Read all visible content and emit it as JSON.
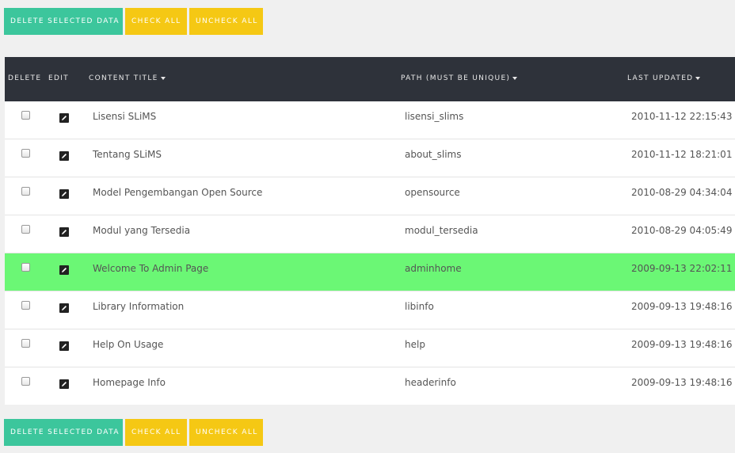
{
  "toolbar": {
    "delete_label": "DELETE SELECTED DATA",
    "check_all_label": "CHECK ALL",
    "uncheck_all_label": "UNCHECK ALL"
  },
  "table": {
    "headers": {
      "delete": "DELETE",
      "edit": "EDIT",
      "title": "CONTENT TITLE",
      "path": "PATH (MUST BE UNIQUE)",
      "updated": "LAST UPDATED"
    },
    "rows": [
      {
        "title": "Lisensi SLiMS",
        "path": "lisensi_slims",
        "updated": "2010-11-12 22:15:43"
      },
      {
        "title": "Tentang SLiMS",
        "path": "about_slims",
        "updated": "2010-11-12 18:21:01"
      },
      {
        "title": "Model Pengembangan Open Source",
        "path": "opensource",
        "updated": "2010-08-29 04:34:04"
      },
      {
        "title": "Modul yang Tersedia",
        "path": "modul_tersedia",
        "updated": "2010-08-29 04:05:49"
      },
      {
        "title": "Welcome To Admin Page",
        "path": "adminhome",
        "updated": "2009-09-13 22:02:11"
      },
      {
        "title": "Library Information",
        "path": "libinfo",
        "updated": "2009-09-13 19:48:16"
      },
      {
        "title": "Help On Usage",
        "path": "help",
        "updated": "2009-09-13 19:48:16"
      },
      {
        "title": "Homepage Info",
        "path": "headerinfo",
        "updated": "2009-09-13 19:48:16"
      }
    ]
  },
  "colors": {
    "delete_button": "#3cc69c",
    "check_buttons": "#f5c814",
    "header_bg": "#2e323a",
    "highlight_row": "#6bf775"
  },
  "icons": {
    "edit": "pencil-icon",
    "sort": "caret-down-icon"
  }
}
